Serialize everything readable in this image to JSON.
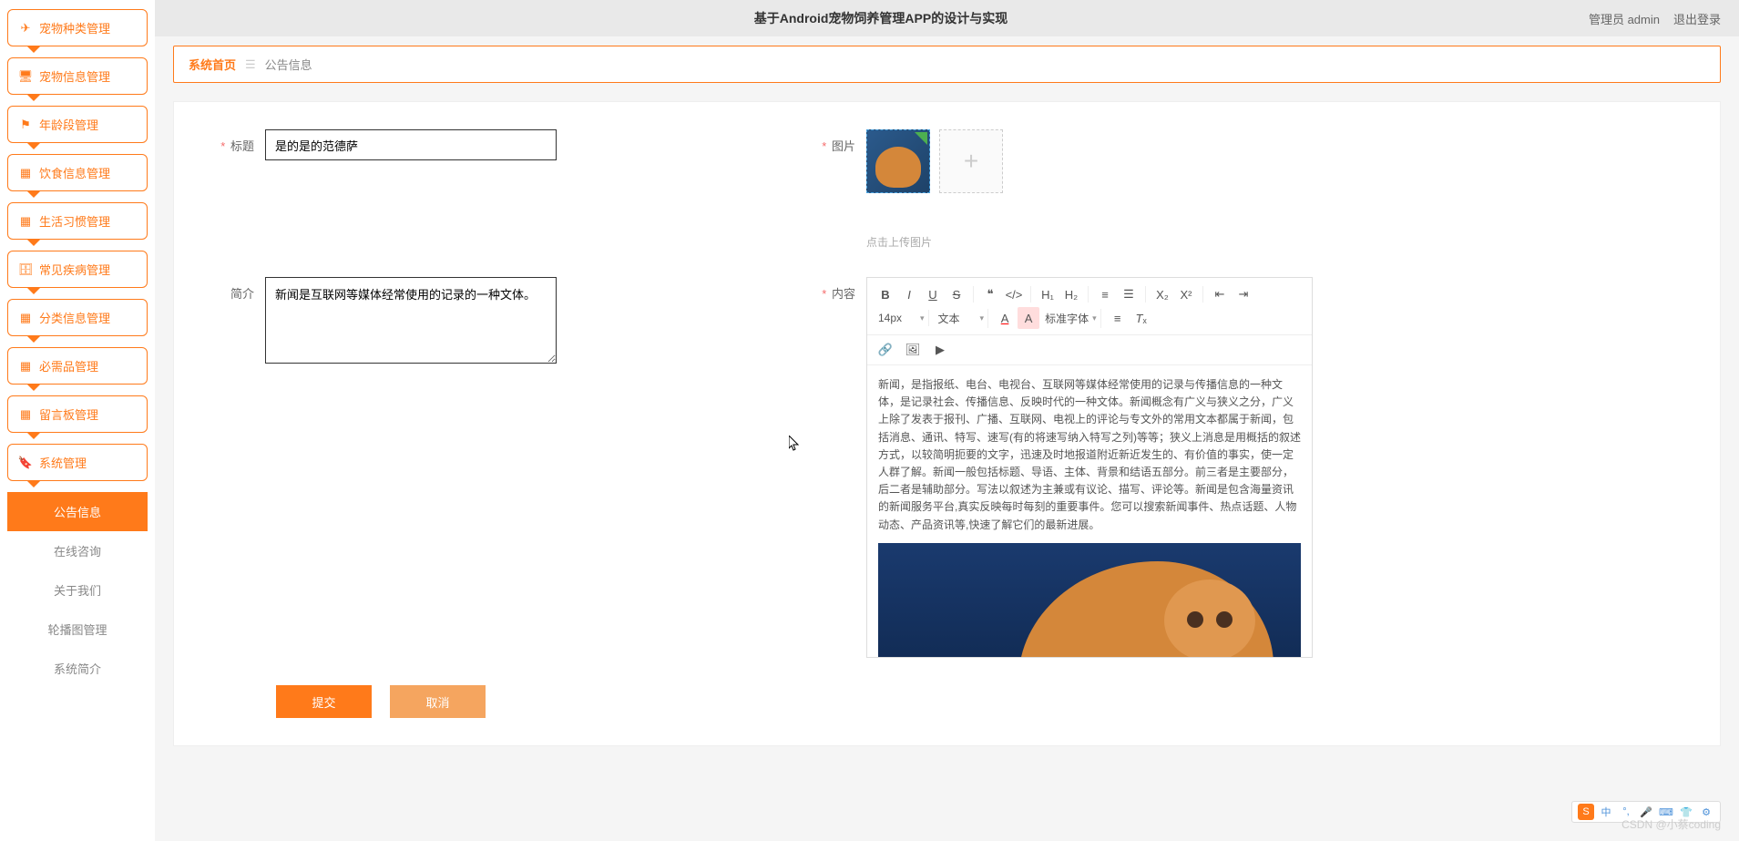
{
  "header": {
    "title": "基于Android宠物饲养管理APP的设计与实现",
    "user_role": "管理员 admin",
    "logout": "退出登录"
  },
  "sidebar": {
    "items": [
      {
        "label": "宠物种类管理",
        "icon": "send"
      },
      {
        "label": "宠物信息管理",
        "icon": "monitor"
      },
      {
        "label": "年龄段管理",
        "icon": "flag"
      },
      {
        "label": "饮食信息管理",
        "icon": "grid"
      },
      {
        "label": "生活习惯管理",
        "icon": "grid"
      },
      {
        "label": "常见疾病管理",
        "icon": "briefcase"
      },
      {
        "label": "分类信息管理",
        "icon": "grid"
      },
      {
        "label": "必需品管理",
        "icon": "grid"
      },
      {
        "label": "留言板管理",
        "icon": "grid"
      },
      {
        "label": "系统管理",
        "icon": "tag"
      }
    ],
    "submenu": [
      {
        "label": "公告信息",
        "active": true
      },
      {
        "label": "在线咨询",
        "active": false
      },
      {
        "label": "关于我们",
        "active": false
      },
      {
        "label": "轮播图管理",
        "active": false
      },
      {
        "label": "系统简介",
        "active": false
      }
    ]
  },
  "breadcrumb": {
    "home": "系统首页",
    "current": "公告信息"
  },
  "form": {
    "title_label": "标题",
    "title_value": "是的是的范德萨",
    "image_label": "图片",
    "image_hint": "点击上传图片",
    "intro_label": "简介",
    "intro_value": "新闻是互联网等媒体经常使用的记录的一种文体。",
    "content_label": "内容",
    "content_text": "新闻，是指报纸、电台、电视台、互联网等媒体经常使用的记录与传播信息的一种文体，是记录社会、传播信息、反映时代的一种文体。新闻概念有广义与狭义之分，广义上除了发表于报刊、广播、互联网、电视上的评论与专文外的常用文本都属于新闻，包括消息、通讯、特写、速写(有的将速写纳入特写之列)等等；狭义上消息是用概括的叙述方式，以较简明扼要的文字，迅速及时地报道附近新近发生的、有价值的事实，使一定人群了解。新闻一般包括标题、导语、主体、背景和结语五部分。前三者是主要部分，后二者是辅助部分。写法以叙述为主兼或有议论、描写、评论等。新闻是包含海量资讯的新闻服务平台,真实反映每时每刻的重要事件。您可以搜索新闻事件、热点话题、人物动态、产品资讯等,快速了解它们的最新进展。",
    "editor": {
      "font_size": "14px",
      "text_type": "文本",
      "font_family": "标准字体"
    }
  },
  "actions": {
    "submit": "提交",
    "cancel": "取消"
  },
  "watermark": "CSDN @小蔡coding",
  "ime": {
    "lang": "中"
  }
}
